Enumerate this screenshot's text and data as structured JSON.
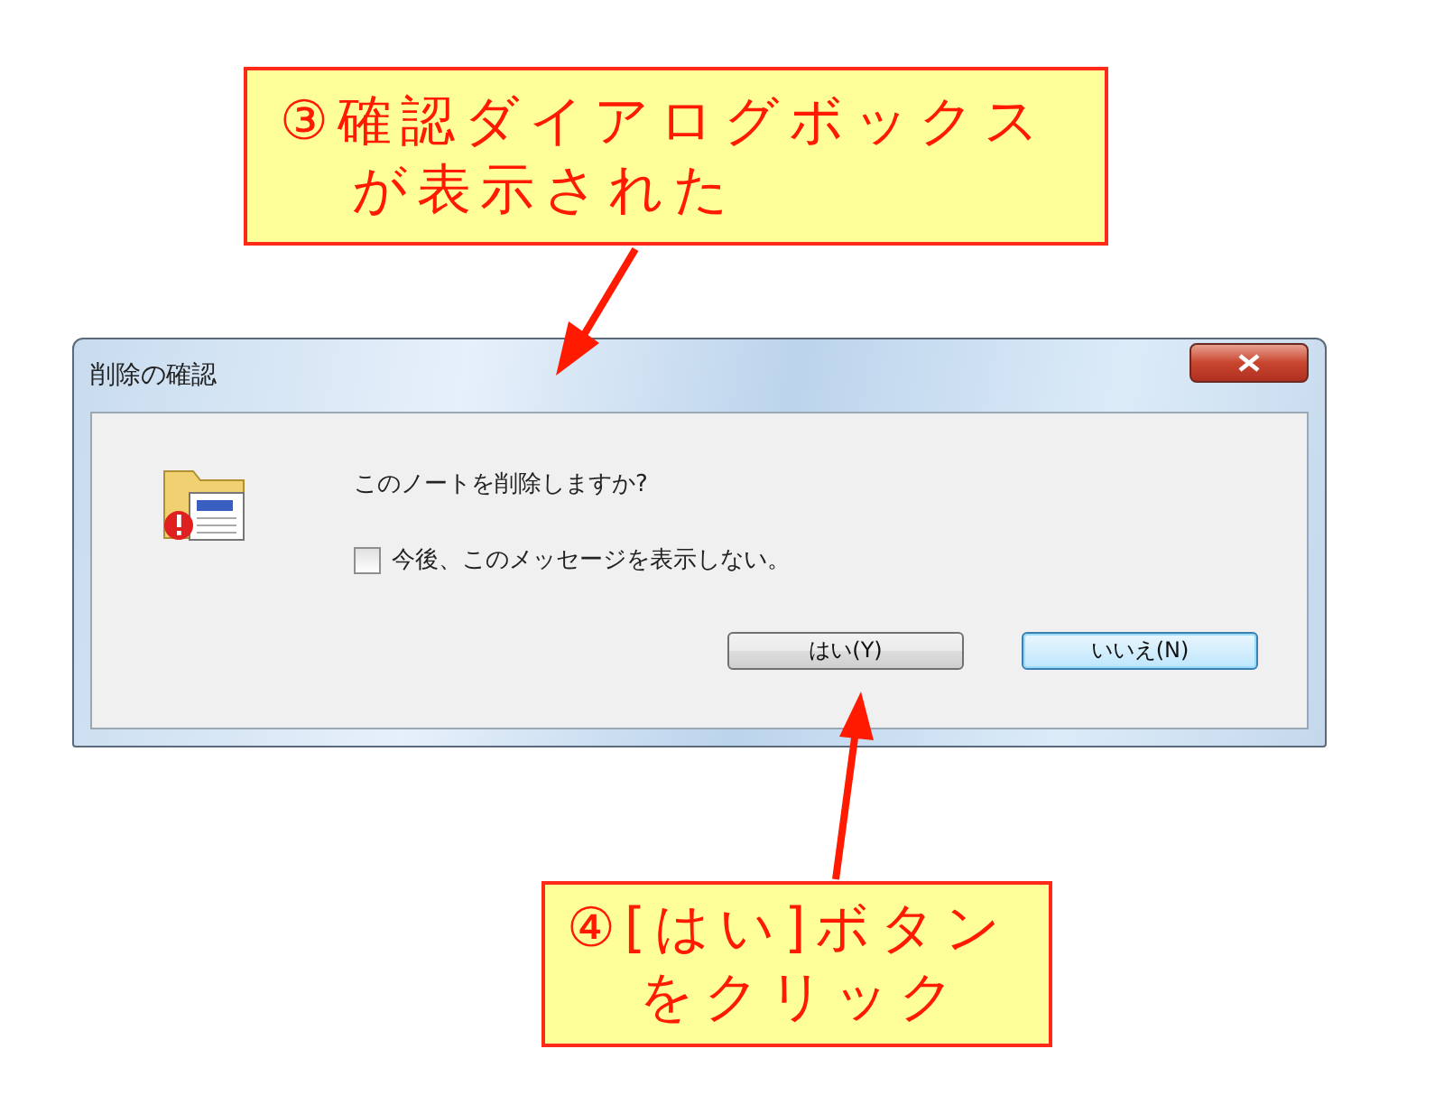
{
  "callout_top": {
    "lines": [
      "③確認ダイアログボックス",
      "が表示された"
    ]
  },
  "dialog": {
    "title": "削除の確認",
    "message": "このノートを削除しますか?",
    "checkbox": {
      "label": "今後、このメッセージを表示しない。",
      "checked": false
    },
    "buttons": [
      {
        "label": "はい(Y)",
        "default": false
      },
      {
        "label": "いいえ(N)",
        "default": true
      }
    ]
  },
  "callout_bottom": {
    "lines": [
      "④[はい]ボタン",
      "をクリック"
    ]
  }
}
